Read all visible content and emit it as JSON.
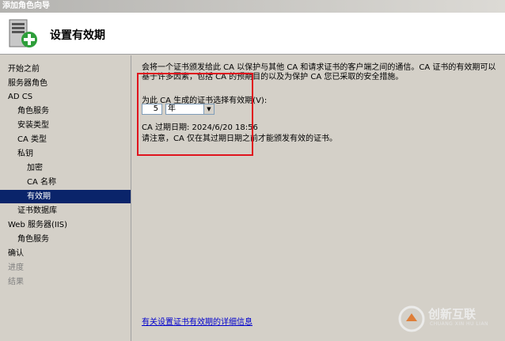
{
  "window": {
    "title": "添加角色向导"
  },
  "header": {
    "title": "设置有效期",
    "icon": "server-add-icon"
  },
  "sidebar": {
    "items": [
      {
        "label": "开始之前",
        "state": "normal"
      },
      {
        "label": "服务器角色",
        "state": "normal"
      },
      {
        "label": "AD CS",
        "state": "normal"
      },
      {
        "label": "角色服务",
        "state": "normal"
      },
      {
        "label": "安装类型",
        "state": "normal"
      },
      {
        "label": "CA 类型",
        "state": "normal"
      },
      {
        "label": "私钥",
        "state": "normal"
      },
      {
        "label": "加密",
        "state": "normal"
      },
      {
        "label": "CA 名称",
        "state": "normal"
      },
      {
        "label": "有效期",
        "state": "active"
      },
      {
        "label": "证书数据库",
        "state": "normal"
      },
      {
        "label": "Web 服务器(IIS)",
        "state": "normal"
      },
      {
        "label": "角色服务",
        "state": "normal"
      },
      {
        "label": "确认",
        "state": "normal"
      },
      {
        "label": "进度",
        "state": "muted"
      },
      {
        "label": "结果",
        "state": "muted"
      }
    ]
  },
  "main": {
    "intro": "会将一个证书颁发给此 CA 以保护与其他 CA 和请求证书的客户端之间的通信。CA 证书的有效期可以基于许多因素，包括 CA 的预期目的以及为保护 CA 您已采取的安全措施。",
    "validity_label": "为此 CA 生成的证书选择有效期(V):",
    "validity_value": "5",
    "validity_unit": "年",
    "expiration": "CA 过期日期:  2024/6/20 18:56",
    "note": "请注意，CA 仅在其过期日期之前才能颁发有效的证书。",
    "help_link": "有关设置证书有效期的详细信息"
  },
  "watermark": {
    "text": "创新互联",
    "subtext": "CHUANG XIN HU LIAN"
  },
  "colors": {
    "selection": "#0a246a",
    "highlight_box": "#e0141e",
    "link": "#0000cc"
  }
}
